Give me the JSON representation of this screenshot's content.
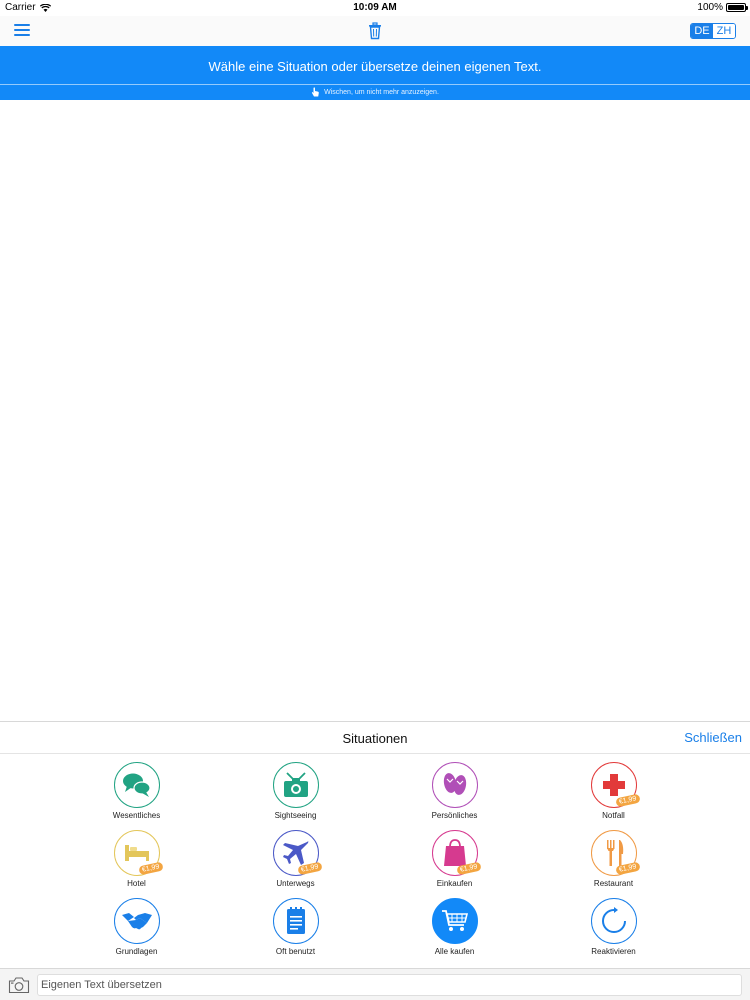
{
  "status_bar": {
    "carrier": "Carrier",
    "time": "10:09 AM",
    "battery": "100%"
  },
  "toolbar": {
    "menu_icon": "hamburger-menu-icon",
    "trash_icon": "trash-icon",
    "languages": [
      "DE",
      "ZH"
    ],
    "active_language": "DE",
    "accent_color": "#1a7fe8"
  },
  "banner": {
    "message": "Wähle eine Situation oder übersetze deinen eigenen Text.",
    "hint": "Wischen, um nicht mehr anzuzeigen.",
    "background_color": "#1289f8"
  },
  "panel": {
    "title": "Situationen",
    "close_label": "Schließen",
    "items": [
      {
        "label": "Wesentliches",
        "icon": "chat-bubbles-icon",
        "color": "#21a383",
        "price": ""
      },
      {
        "label": "Sightseeing",
        "icon": "camera-icon",
        "color": "#21a383",
        "price": ""
      },
      {
        "label": "Persönliches",
        "icon": "flip-flops-icon",
        "color": "#b04fb7",
        "price": ""
      },
      {
        "label": "Notfall",
        "icon": "medical-cross-icon",
        "color": "#e23a3a",
        "price": "€1,99"
      },
      {
        "label": "Hotel",
        "icon": "bed-icon",
        "color": "#e3c65a",
        "price": "€1,99"
      },
      {
        "label": "Unterwegs",
        "icon": "airplane-icon",
        "color": "#4b59c7",
        "price": "€1,99"
      },
      {
        "label": "Einkaufen",
        "icon": "shopping-bag-icon",
        "color": "#d63a8f",
        "price": "€1,99"
      },
      {
        "label": "Restaurant",
        "icon": "fork-knife-icon",
        "color": "#f09a45",
        "price": "€1,99"
      },
      {
        "label": "Grundlagen",
        "icon": "handshake-icon",
        "color": "#1a7fe8",
        "price": ""
      },
      {
        "label": "Oft benutzt",
        "icon": "notepad-icon",
        "color": "#1a7fe8",
        "price": ""
      },
      {
        "label": "Alle kaufen",
        "icon": "shopping-cart-icon",
        "color": "#1289f8",
        "price": ""
      },
      {
        "label": "Reaktivieren",
        "icon": "refresh-icon",
        "color": "#1a7fe8",
        "price": ""
      }
    ]
  },
  "input_bar": {
    "camera_icon": "camera-icon",
    "placeholder": "Eigenen Text übersetzen"
  }
}
